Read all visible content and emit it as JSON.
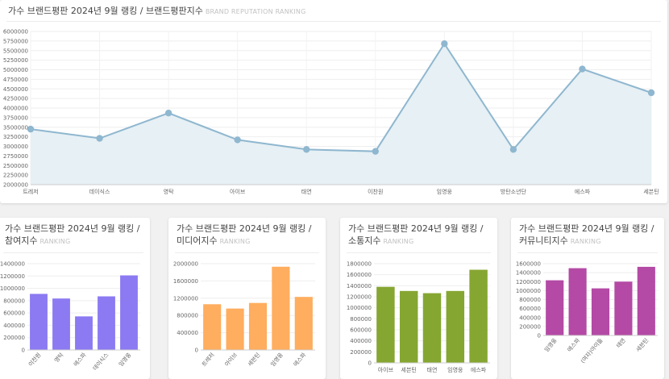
{
  "charts": [
    {
      "id": "main",
      "title": "가수 브랜드평판 2024년 9월 랭킹 / 브랜드평판지수",
      "subtitle": "BRAND REPUTATION RANKING",
      "color": "#8fb7cf",
      "chart_data": {
        "type": "area",
        "categories": [
          "트레저",
          "데이식스",
          "영탁",
          "아이브",
          "태연",
          "이찬원",
          "임영웅",
          "방탄소년단",
          "에스파",
          "세븐틴"
        ],
        "values": [
          3450000,
          3210000,
          3870000,
          3170000,
          2920000,
          2870000,
          5680000,
          2920000,
          5020000,
          4400000
        ],
        "ylim": [
          2000000,
          6000000
        ],
        "ytick_step": 250000,
        "grid": true
      }
    },
    {
      "id": "participation",
      "title": "가수 브랜드평판 2024년 9월 랭킹 / 참여지수",
      "subtitle": "RANKING",
      "color": "#8b7af2",
      "chart_data": {
        "type": "bar",
        "categories": [
          "이찬원",
          "영탁",
          "에스파",
          "데이식스",
          "임영웅"
        ],
        "values": [
          910000,
          835000,
          545000,
          870000,
          1210000
        ],
        "ylim": [
          0,
          1400000
        ],
        "ytick_step": 200000
      }
    },
    {
      "id": "media",
      "title": "가수 브랜드평판 2024년 9월 랭킹 / 미디어지수",
      "subtitle": "RANKING",
      "color": "#ffad5e",
      "chart_data": {
        "type": "bar",
        "categories": [
          "트레저",
          "아이브",
          "세븐틴",
          "임영웅",
          "에스파"
        ],
        "values": [
          1060000,
          960000,
          1090000,
          1930000,
          1230000
        ],
        "ylim": [
          0,
          2000000
        ],
        "ytick_step": 400000
      }
    },
    {
      "id": "communication",
      "title": "가수 브랜드평판 2024년 9월 랭킹 / 소통지수",
      "subtitle": "RANKING",
      "color": "#86a632",
      "chart_data": {
        "type": "bar",
        "categories": [
          "아이브",
          "세븐틴",
          "태연",
          "임영웅",
          "에스파"
        ],
        "values": [
          1380000,
          1305000,
          1265000,
          1305000,
          1690000
        ],
        "ylim": [
          0,
          1800000
        ],
        "ytick_step": 200000
      }
    },
    {
      "id": "community",
      "title": "가수 브랜드평판 2024년 9월 랭킹 / 커뮤니티지수",
      "subtitle": "RANKING",
      "color": "#b44aa5",
      "chart_data": {
        "type": "bar",
        "categories": [
          "임영웅",
          "에스파",
          "(여자)아이들",
          "태연",
          "세븐틴"
        ],
        "values": [
          1230000,
          1500000,
          1050000,
          1200000,
          1530000
        ],
        "ylim": [
          0,
          1600000
        ],
        "ytick_step": 200000
      }
    }
  ]
}
